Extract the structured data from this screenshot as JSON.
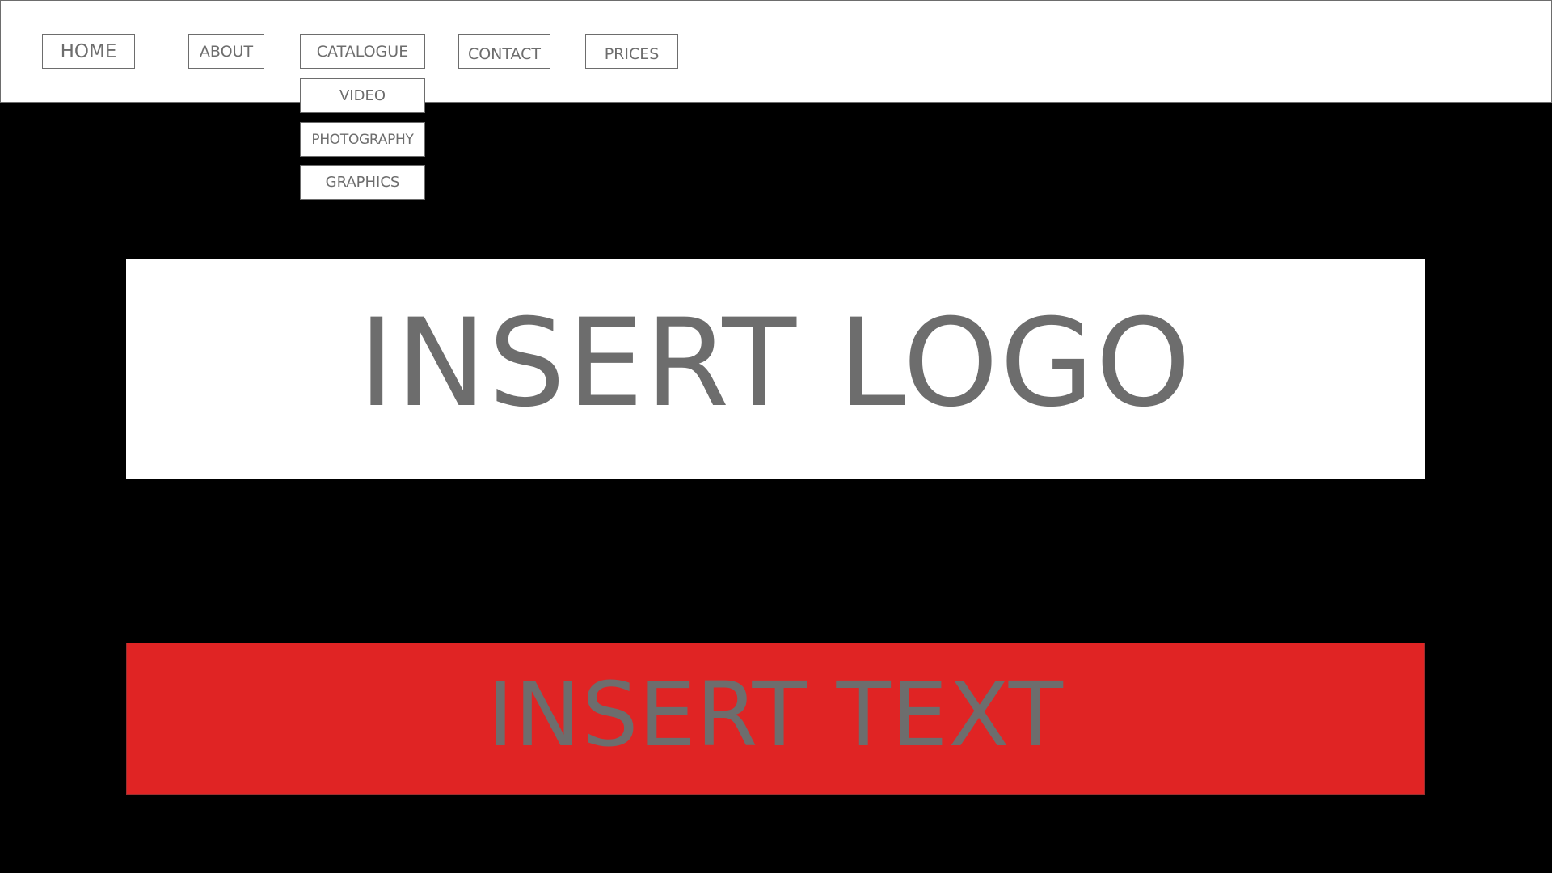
{
  "nav": {
    "home": "HOME",
    "about": "ABOUT",
    "catalogue": "CATALOGUE",
    "contact": "CONTACT",
    "prices": "PRICES"
  },
  "catalogue_dropdown": {
    "items": [
      "VIDEO",
      "PHOTOGRAPHY",
      "GRAPHICS"
    ]
  },
  "hero": {
    "logo_placeholder": "INSERT LOGO",
    "text_placeholder": "INSERT TEXT"
  },
  "colors": {
    "background": "#000000",
    "header": "#ffffff",
    "text_gray": "#6d6d6d",
    "accent_red": "#e02424"
  }
}
